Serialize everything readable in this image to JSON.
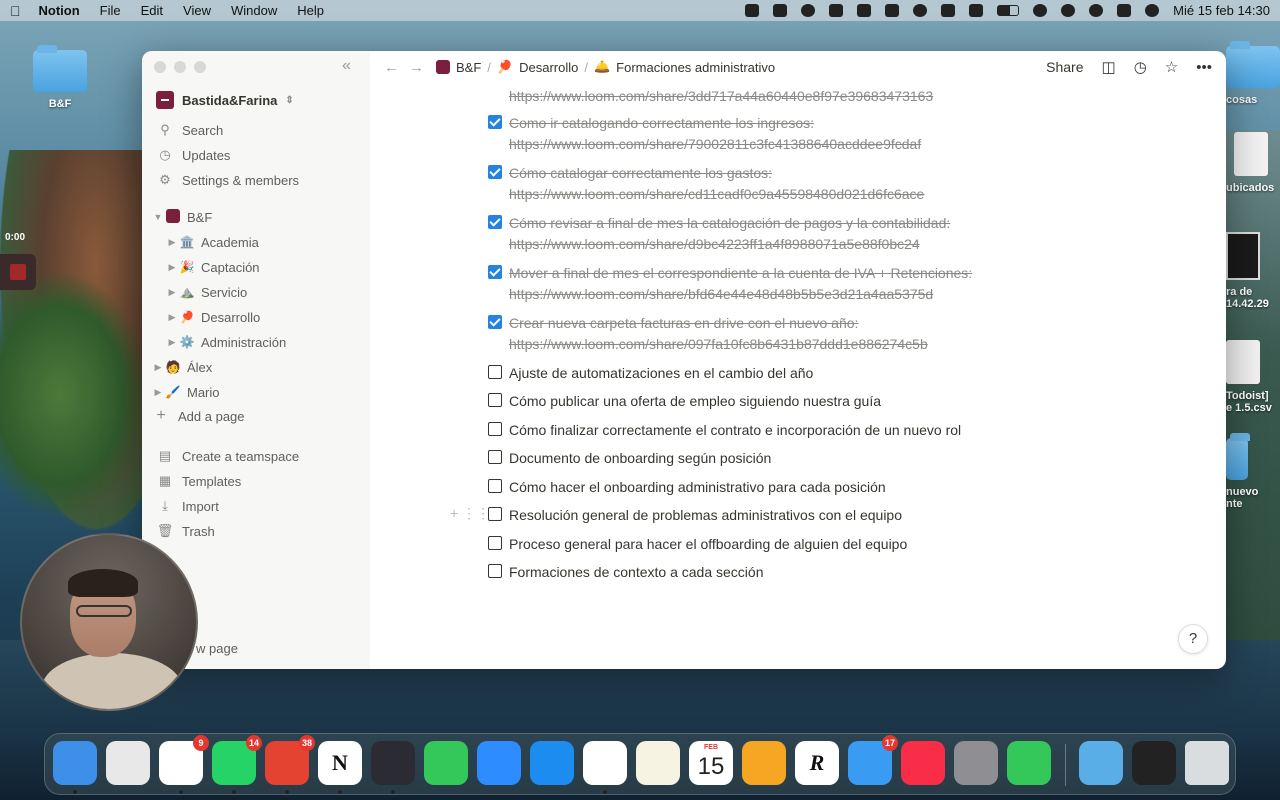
{
  "menubar": {
    "app_name": "Notion",
    "menus": [
      "File",
      "Edit",
      "View",
      "Window",
      "Help"
    ],
    "datetime": "Mié 15 feb 14:30"
  },
  "desktop": {
    "left_folder_label": "B&F",
    "timer": "0:00",
    "right_labels": [
      "cosas",
      "ubicados",
      "ra de",
      "14.42.29",
      "Todoist]",
      "e 1.5.csv",
      "nuevo",
      "nte"
    ]
  },
  "sidebar": {
    "workspace": "Bastida&Farina",
    "top_items": [
      {
        "label": "Search",
        "icon": "search-icon"
      },
      {
        "label": "Updates",
        "icon": "clock-icon"
      },
      {
        "label": "Settings & members",
        "icon": "gear-icon"
      }
    ],
    "teamspace": "B&F",
    "pages": [
      {
        "label": "Academia",
        "icon": "🏛️"
      },
      {
        "label": "Captación",
        "icon": "🎉"
      },
      {
        "label": "Servicio",
        "icon": "⛰️"
      },
      {
        "label": "Desarrollo",
        "icon": "🏓"
      },
      {
        "label": "Administración",
        "icon": "⚙️"
      }
    ],
    "people": [
      {
        "label": "Álex",
        "icon": "🧑"
      },
      {
        "label": "Mario",
        "icon": "🖌️"
      }
    ],
    "add_page": "Add a page",
    "bottom_items": [
      {
        "label": "Create a teamspace",
        "icon": "teamspace-icon"
      },
      {
        "label": "Templates",
        "icon": "template-icon"
      },
      {
        "label": "Import",
        "icon": "import-icon"
      },
      {
        "label": "Trash",
        "icon": "trash-icon"
      }
    ],
    "new_page": "w page"
  },
  "topbar": {
    "breadcrumbs": [
      {
        "label": "B&F",
        "icon": "workspace-logo"
      },
      {
        "label": "Desarrollo",
        "icon": "🏓"
      },
      {
        "label": "Formaciones administrativo",
        "icon": "🛎️"
      }
    ],
    "share_label": "Share"
  },
  "content": {
    "first_url": "https://www.loom.com/share/3dd717a44a60440e8f97e39683473163",
    "todos": [
      {
        "text": "Como ir catalogando correctamente los ingresos:",
        "url": "https://www.loom.com/share/79002811c3fc41388640acddee9fcdaf",
        "checked": true
      },
      {
        "text": "Cómo catalogar correctamente los gastos:",
        "url": "https://www.loom.com/share/cd11cadf0c9a45598480d021d6fc6ace",
        "checked": true
      },
      {
        "text": "Cómo revisar a final de mes la catalogación de pagos y la contabilidad:",
        "url": "https://www.loom.com/share/d9bc4223ff1a4f8988071a5e88f0bc24",
        "checked": true
      },
      {
        "text": "Mover a final de mes el correspondiente a la cuenta de IVA + Retenciones:",
        "url": "https://www.loom.com/share/bfd64e44e48d48b5b5e3d21a4aa5375d",
        "checked": true
      },
      {
        "text": "Crear nueva carpeta facturas en drive con el nuevo año:",
        "url": "https://www.loom.com/share/097fa10fc8b6431b87ddd1e886274c5b",
        "checked": true
      },
      {
        "text": "Ajuste de automatizaciones en el cambio del año",
        "url": "",
        "checked": false
      },
      {
        "text": "Cómo publicar una oferta de empleo siguiendo nuestra guía",
        "url": "",
        "checked": false
      },
      {
        "text": "Cómo finalizar correctamente el contrato e incorporación de un nuevo rol",
        "url": "",
        "checked": false
      },
      {
        "text": "Documento de onboarding según posición",
        "url": "",
        "checked": false
      },
      {
        "text": "Cómo hacer el onboarding administrativo para cada posición",
        "url": "",
        "checked": false
      },
      {
        "text": "Resolución general de problemas administrativos con el equipo",
        "url": "",
        "checked": false
      },
      {
        "text": "Proceso general para hacer el offboarding de alguien del equipo",
        "url": "",
        "checked": false
      },
      {
        "text": "Formaciones de contexto a cada sección",
        "url": "",
        "checked": false
      }
    ],
    "help_label": "?"
  },
  "dock": {
    "apps": [
      {
        "name": "Finder",
        "color": "#3d8fe8",
        "badge": ""
      },
      {
        "name": "Launchpad",
        "color": "#e8e8e8",
        "badge": ""
      },
      {
        "name": "Slack",
        "color": "#ffffff",
        "badge": "9"
      },
      {
        "name": "WhatsApp",
        "color": "#25d366",
        "badge": "14"
      },
      {
        "name": "Todoist",
        "color": "#e44332",
        "badge": "38"
      },
      {
        "name": "Notion",
        "color": "#ffffff",
        "badge": ""
      },
      {
        "name": "OBS",
        "color": "#2b2b33",
        "badge": ""
      },
      {
        "name": "FaceTime",
        "color": "#34c759",
        "badge": ""
      },
      {
        "name": "Zoom",
        "color": "#2d8cff",
        "badge": ""
      },
      {
        "name": "Safari",
        "color": "#1c8cf0",
        "badge": ""
      },
      {
        "name": "Chrome",
        "color": "#ffffff",
        "badge": ""
      },
      {
        "name": "Notes",
        "color": "#f7f3e3",
        "badge": ""
      },
      {
        "name": "Calendar",
        "color": "#ffffff",
        "badge": ""
      },
      {
        "name": "Pages",
        "color": "#f5a623",
        "badge": ""
      },
      {
        "name": "Reeder",
        "color": "#ffffff",
        "badge": ""
      },
      {
        "name": "Mail",
        "color": "#3a9bf2",
        "badge": "17"
      },
      {
        "name": "Music",
        "color": "#fa2d48",
        "badge": ""
      },
      {
        "name": "System Settings",
        "color": "#8e8e93",
        "badge": ""
      },
      {
        "name": "Messages",
        "color": "#34c759",
        "badge": ""
      }
    ],
    "calendar_month": "FEB",
    "calendar_day": "15",
    "notion_glyph": "N",
    "reeder_glyph": "R"
  }
}
